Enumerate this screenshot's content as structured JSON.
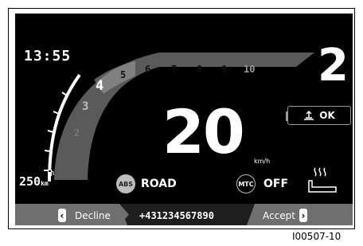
{
  "clock": {
    "time": "13:55"
  },
  "rpm_scale": {
    "labels": [
      "2",
      "3",
      "4",
      "5",
      "6",
      "7",
      "8",
      "9",
      "10"
    ],
    "active": "4"
  },
  "gear": {
    "value": "2"
  },
  "speed": {
    "value": "20",
    "unit": "km/h"
  },
  "traction_control": {
    "icon": "traction-control-icon",
    "status": "OK"
  },
  "range": {
    "value": "250",
    "unit": "km",
    "icon": "fuel-pump-icon"
  },
  "riding_mode": {
    "badge": "ABS",
    "value": "ROAD"
  },
  "mtc": {
    "badge": "MTC",
    "value": "OFF"
  },
  "heated_grips": {
    "icon": "heated-grip-icon"
  },
  "call": {
    "decline_label": "Decline",
    "number": "+431234567890",
    "accept_label": "Accept"
  },
  "caption": "I00507-10",
  "colors": {
    "background": "#000000",
    "text": "#ffffff",
    "arc": "#5a5a5a",
    "bar": "#6f6f6f"
  }
}
